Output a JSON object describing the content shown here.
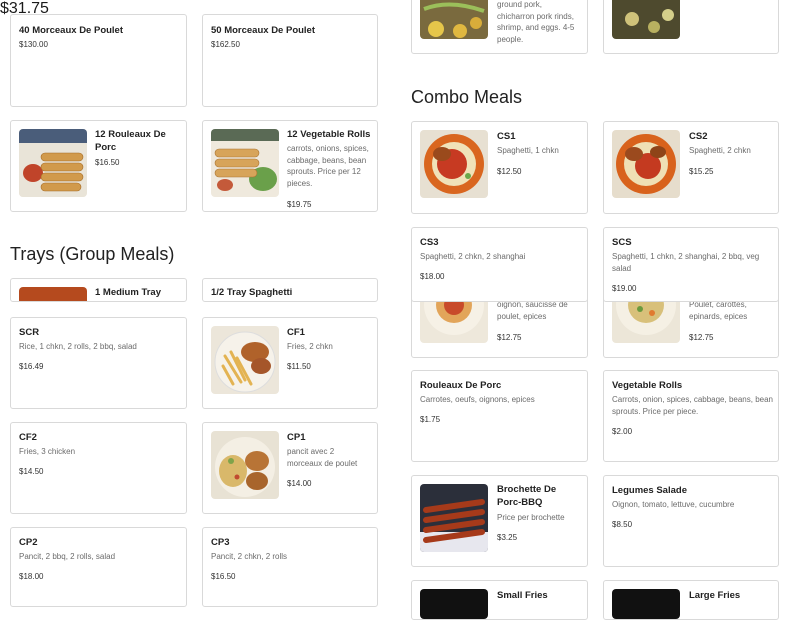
{
  "colors": {
    "border": "#d9d9d9",
    "text": "#222222",
    "muted": "#6b6b6b"
  },
  "sections": {
    "combo_title": "Combo Meals",
    "trays_title": "Trays (Group Meals)"
  },
  "items": {
    "poulet40": {
      "name": "40 Morceaux De Poulet",
      "price": "$130.00"
    },
    "poulet50": {
      "name": "50 Morceaux De Poulet",
      "price": "$162.50"
    },
    "top1": {
      "desc": "ground pork, chicharron pork rinds, shrimp, and eggs. 4-5 people.",
      "price": "$31.75"
    },
    "rouleaux12": {
      "name": "12 Rouleaux De Porc",
      "price": "$16.50"
    },
    "veg12": {
      "name": "12 Vegetable Rolls",
      "desc": "carrots, onions, spices, cabbage, beans, bean sprouts. Price per 12 pieces.",
      "price": "$19.75"
    },
    "cs1": {
      "name": "CS1",
      "desc": "Spaghetti, 1 chkn",
      "price": "$12.50"
    },
    "cs2": {
      "name": "CS2",
      "desc": "Spaghetti, 2 chkn",
      "price": "$15.25"
    },
    "cs3": {
      "name": "CS3",
      "desc": "Spaghetti, 2 chkn, 2 shanghai",
      "price": "$18.00"
    },
    "scs": {
      "name": "SCS",
      "desc": "Spaghetti, 1 chkn, 2 shanghai, 2 bbq, veg salad",
      "price": "$19.00"
    },
    "under1": {
      "desc": "oignon, saucisse de poulet, epices",
      "price": "$12.75"
    },
    "under2": {
      "desc": "Poulet, carottes, epinards, epices",
      "price": "$12.75"
    },
    "tray_medium": {
      "name": "1 Medium Tray"
    },
    "tray_half": {
      "name": "1/2 Tray Spaghetti"
    },
    "scr": {
      "name": "SCR",
      "desc": "Rice, 1 chkn, 2 rolls, 2 bbq, salad",
      "price": "$16.49"
    },
    "cf1": {
      "name": "CF1",
      "desc": "Fries, 2 chkn",
      "price": "$11.50"
    },
    "cf2": {
      "name": "CF2",
      "desc": "Fries, 3 chicken",
      "price": "$14.50"
    },
    "cp1": {
      "name": "CP1",
      "desc": "pancit avec 2 morceaux de poulet",
      "price": "$14.00"
    },
    "cp2": {
      "name": "CP2",
      "desc": "Pancit, 2 bbq, 2 rolls, salad",
      "price": "$18.00"
    },
    "cp3": {
      "name": "CP3",
      "desc": "Pancit, 2 chkn, 2 rolls",
      "price": "$16.50"
    },
    "rouleaux": {
      "name": "Rouleaux De Porc",
      "desc": "Carrotes, oeufs, oignons, epices",
      "price": "$1.75"
    },
    "vegrolls": {
      "name": "Vegetable Rolls",
      "desc": "Carrots, onion, spices, cabbage, beans, bean sprouts. Price per piece.",
      "price": "$2.00"
    },
    "brochette": {
      "name": "Brochette De Porc-BBQ",
      "desc": "Price per brochette",
      "price": "$3.25"
    },
    "legumes": {
      "name": "Legumes Salade",
      "desc": "Oignon, tomato, lettuve, cucumbre",
      "price": "$8.50"
    },
    "smallfries": {
      "name": "Small Fries"
    },
    "largefries": {
      "name": "Large Fries"
    }
  }
}
